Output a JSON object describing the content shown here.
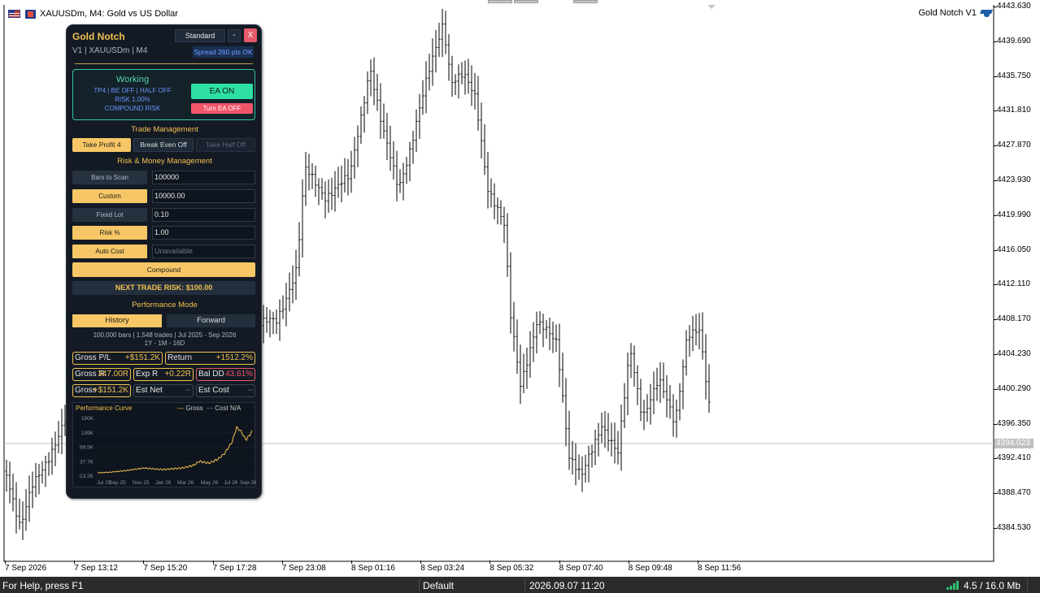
{
  "chart_window": {
    "symbol_title": "XAUUSDm, M4:  Gold vs US Dollar",
    "ea_label": "Gold Notch V1",
    "current_price": "4394.023",
    "price_labels": [
      "4443.630",
      "4439.690",
      "4435.750",
      "4431.810",
      "4427.870",
      "4423.930",
      "4419.990",
      "4416.050",
      "4412.110",
      "4408.170",
      "4404.230",
      "4400.290",
      "4396.350",
      "4392.410",
      "4388.470",
      "4384.530"
    ],
    "time_labels": [
      "7 Sep 2026",
      "7 Sep 13:12",
      "7 Sep 15:20",
      "7 Sep 17:28",
      "7 Sep 23:08",
      "8 Sep 01:16",
      "8 Sep 03:24",
      "8 Sep 05:32",
      "8 Sep 07:40",
      "8 Sep 09:48",
      "8 Sep 11:56"
    ],
    "icons": [
      "flag-icon",
      "broker-icon",
      "graduation-cap-icon"
    ]
  },
  "status_bar": {
    "help": "For Help, press F1",
    "profile": "Default",
    "datetime": "2026.09.07 11:20",
    "connection": "4.5 / 16.0 Mb"
  },
  "panel": {
    "title": "Gold Notch",
    "mode_button": "Standard",
    "minimize": "-",
    "close": "X",
    "subtitle": "V1 | XAUUSDm | M4",
    "spread": "Spread 260 pts OK",
    "status": {
      "state": "Working",
      "line1": "TP4 | BE OFF | HALF OFF",
      "line2": "RISK 1.00%",
      "line3": "COMPOUND RISK",
      "ea_on": "EA ON",
      "turn_off": "Turn EA OFF"
    },
    "trade_management": {
      "title": "Trade Management",
      "take_profit": "Take Profit 4",
      "break_even": "Break Even Off",
      "take_half": "Take Half Off"
    },
    "risk": {
      "title": "Risk & Money Management",
      "rows": [
        {
          "label": "Bars to Scan",
          "value": "100000"
        },
        {
          "label": "Custom",
          "value": "10000.00"
        },
        {
          "label": "Fixed Lot",
          "value": "0.10"
        },
        {
          "label": "Risk %",
          "value": "1.00"
        },
        {
          "label": "Auto Cost",
          "value": "Unavailable"
        }
      ],
      "compound": "Compound",
      "next_trade_risk": "NEXT TRADE RISK: $100.00"
    },
    "performance": {
      "title": "Performance Mode",
      "history": "History",
      "forward": "Forward",
      "info1": "100,000 bars | 1,548 trades | Jul 2025 - Sep 2026",
      "info2": "1Y - 1M - 16D",
      "stats": [
        {
          "k": "Gross P/L",
          "v": "+$151.2K"
        },
        {
          "k": "Return",
          "v": "+1512.2%"
        },
        {
          "k": "Gross R",
          "v": "347.00R"
        },
        {
          "k": "Exp R",
          "v": "+0.22R"
        },
        {
          "k": "Bal DD",
          "v": "43.61%"
        },
        {
          "k": "Gross",
          "v": "+$151.2K"
        },
        {
          "k": "Est Net",
          "v": "--"
        },
        {
          "k": "Est Cost",
          "v": "--"
        }
      ]
    },
    "curve": {
      "title": "Performance Curve",
      "legend_gross": "Gross",
      "legend_cost": "Cost N/A",
      "y_labels": [
        "190K",
        "139K",
        "88.5K",
        "37.7K",
        "-13.2K"
      ],
      "x_labels": [
        "Jul 25",
        "Sep 25",
        "Nov 25",
        "Jan 26",
        "Mar 26",
        "May 26",
        "Jul 26",
        "Sep 26"
      ],
      "line_color": "#f2c14e"
    }
  }
}
